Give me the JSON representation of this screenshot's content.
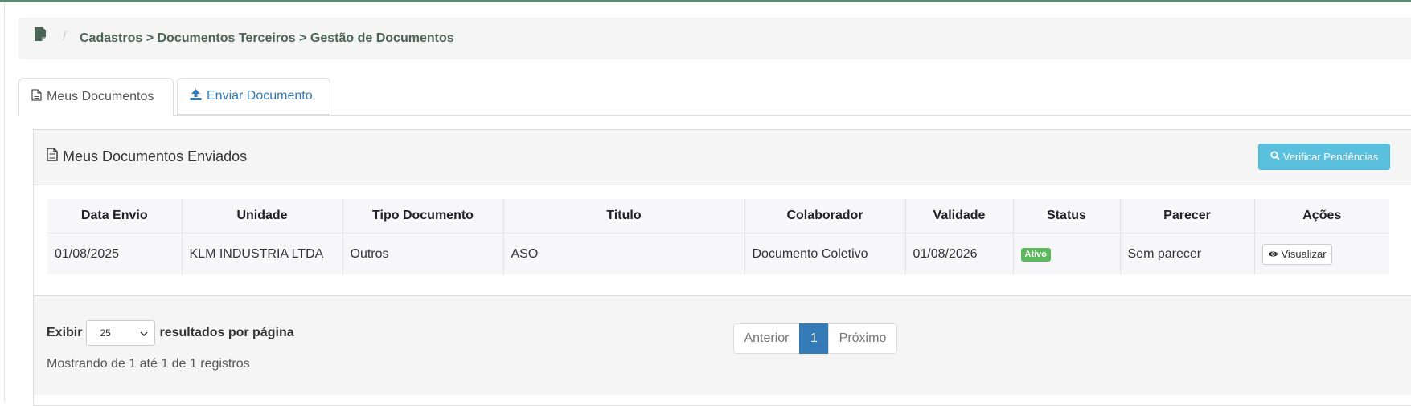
{
  "breadcrumb": {
    "icon": "document-icon",
    "separator": "/",
    "path": "Cadastros > Documentos Terceiros > Gestão de Documentos"
  },
  "tabs": [
    {
      "label": "Meus Documentos",
      "icon": "file-text-icon",
      "active": true
    },
    {
      "label": "Enviar Documento",
      "icon": "upload-icon",
      "active": false
    }
  ],
  "panel": {
    "title": "Meus Documentos Enviados",
    "verify_button": "Verificar Pendências"
  },
  "table": {
    "headers": [
      "Data Envio",
      "Unidade",
      "Tipo Documento",
      "Titulo",
      "Colaborador",
      "Validade",
      "Status",
      "Parecer",
      "Ações"
    ],
    "rows": [
      {
        "data_envio": "01/08/2025",
        "unidade": "KLM INDUSTRIA LTDA",
        "tipo_documento": "Outros",
        "titulo": "ASO",
        "colaborador": "Documento Coletivo",
        "validade": "01/08/2026",
        "status": "Ativo",
        "parecer": "Sem parecer",
        "acao": "Visualizar"
      }
    ]
  },
  "footer": {
    "show_label": "Exibir",
    "page_size": "25",
    "per_page_label": "resultados por página",
    "showing_text": "Mostrando de 1 até 1 de 1 registros"
  },
  "pagination": {
    "prev": "Anterior",
    "current": "1",
    "next": "Próximo"
  },
  "colors": {
    "accent_green": "#4a6556",
    "primary": "#337ab7",
    "info": "#5bc0de",
    "success": "#5cb85c"
  }
}
